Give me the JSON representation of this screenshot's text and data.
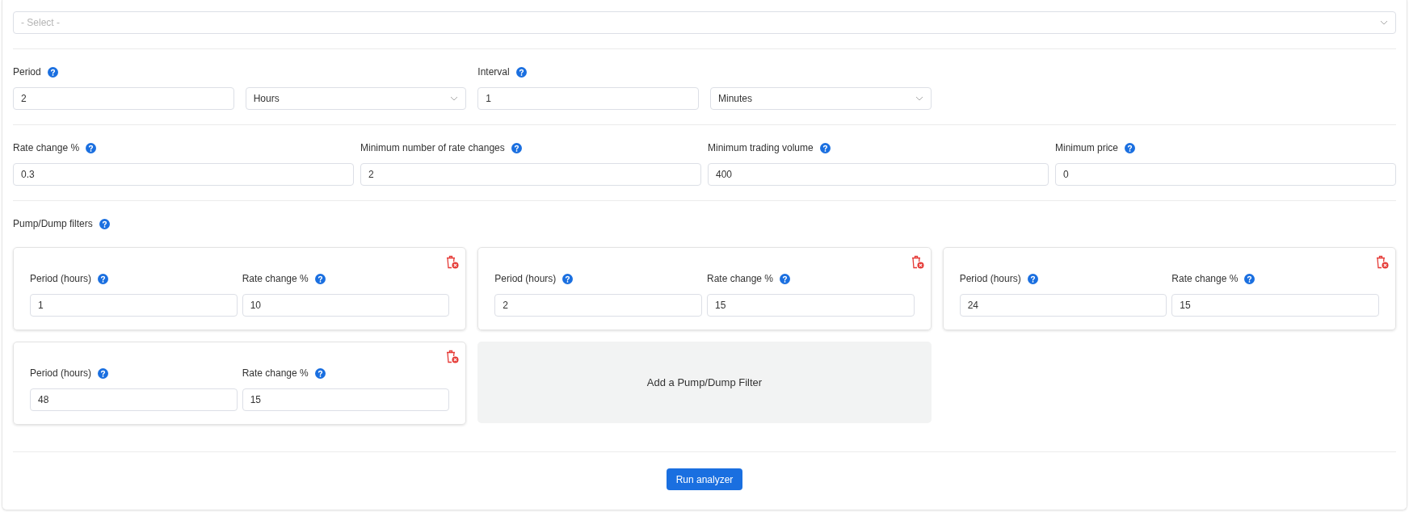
{
  "select": {
    "placeholder": "- Select -"
  },
  "period": {
    "label": "Period",
    "value": "2",
    "unit": "Hours"
  },
  "interval": {
    "label": "Interval",
    "value": "1",
    "unit": "Minutes"
  },
  "thresholds": [
    {
      "label": "Rate change %",
      "value": "0.3"
    },
    {
      "label": "Minimum number of rate changes",
      "value": "2"
    },
    {
      "label": "Minimum trading volume",
      "value": "400"
    },
    {
      "label": "Minimum price",
      "value": "0"
    }
  ],
  "pump_dump": {
    "label": "Pump/Dump filters",
    "filters": [
      {
        "period_label": "Period (hours)",
        "period": "1",
        "rate_label": "Rate change %",
        "rate": "10"
      },
      {
        "period_label": "Period (hours)",
        "period": "2",
        "rate_label": "Rate change %",
        "rate": "15"
      },
      {
        "period_label": "Period (hours)",
        "period": "24",
        "rate_label": "Rate change %",
        "rate": "15"
      },
      {
        "period_label": "Period (hours)",
        "period": "48",
        "rate_label": "Rate change %",
        "rate": "15"
      }
    ],
    "add_label": "Add a Pump/Dump Filter"
  },
  "run_button": "Run analyzer"
}
